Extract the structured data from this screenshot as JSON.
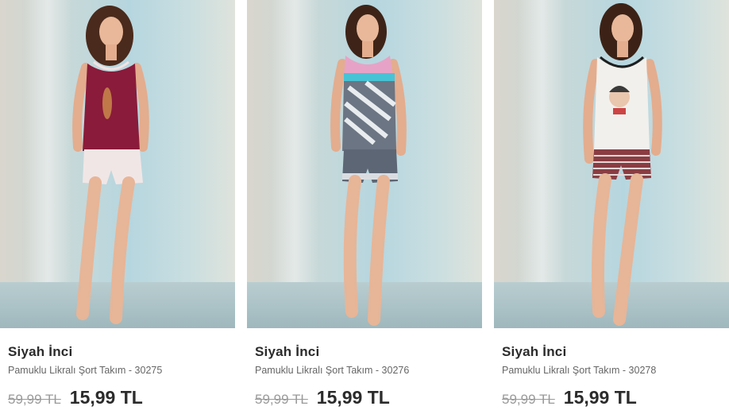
{
  "products": [
    {
      "brand": "Siyah İnci",
      "name": "Pamuklu Likralı Şort Takım - 30275",
      "old_price": "59,99 TL",
      "new_price": "15,99 TL",
      "top_color": "#8a1b3a",
      "bottom_color": "#f1e6e6"
    },
    {
      "brand": "Siyah İnci",
      "name": "Pamuklu Likralı Şort Takım - 30276",
      "old_price": "59,99 TL",
      "new_price": "15,99 TL",
      "top_color": "#6b7583",
      "bottom_color": "#5d6674"
    },
    {
      "brand": "Siyah İnci",
      "name": "Pamuklu Likralı Şort Takım - 30278",
      "old_price": "59,99 TL",
      "new_price": "15,99 TL",
      "top_color": "#f2f0ec",
      "bottom_color": "#8a3d43"
    }
  ]
}
